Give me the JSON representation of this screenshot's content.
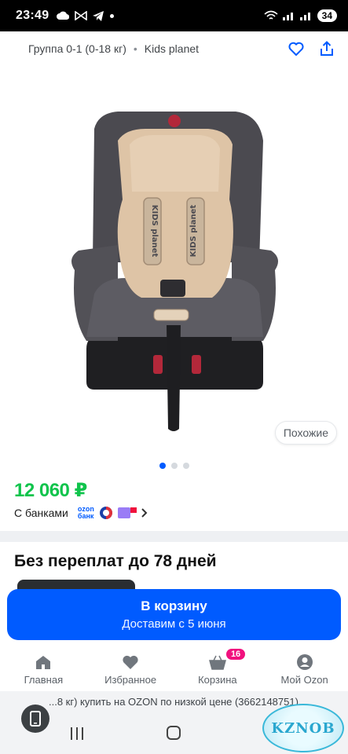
{
  "status_bar": {
    "time": "23:49",
    "battery": "34"
  },
  "header": {
    "category": "Группа 0-1 (0-18 кг)",
    "brand": "Kids planet"
  },
  "gallery": {
    "image_alt": "Автокресло Kids planet",
    "seat_label": "KIDS planet",
    "similar_label": "Похожие",
    "dots": 3,
    "active_dot": 0
  },
  "product": {
    "price": "12 060 ₽",
    "banks_label": "С банками",
    "ozon_bank_top": "ozon",
    "ozon_bank_bottom": "банк"
  },
  "promo": {
    "heading": "Без переплат до 78 дней"
  },
  "cart_button": {
    "label": "В корзину",
    "sublabel": "Доставим с 5 июня"
  },
  "tabbar": {
    "items": [
      {
        "label": "Главная",
        "icon": "home-icon"
      },
      {
        "label": "Избранное",
        "icon": "heart-icon"
      },
      {
        "label": "Корзина",
        "icon": "basket-icon",
        "badge": "16"
      },
      {
        "label": "Мой Ozon",
        "icon": "profile-icon"
      }
    ]
  },
  "url_bar": {
    "text": "...8 кг) купить на OZON по низкой цене (3662148751)"
  },
  "watermark": {
    "text": "KZNOB"
  },
  "colors": {
    "accent": "#005bff",
    "price": "#10c44c",
    "badge": "#f1117e"
  }
}
